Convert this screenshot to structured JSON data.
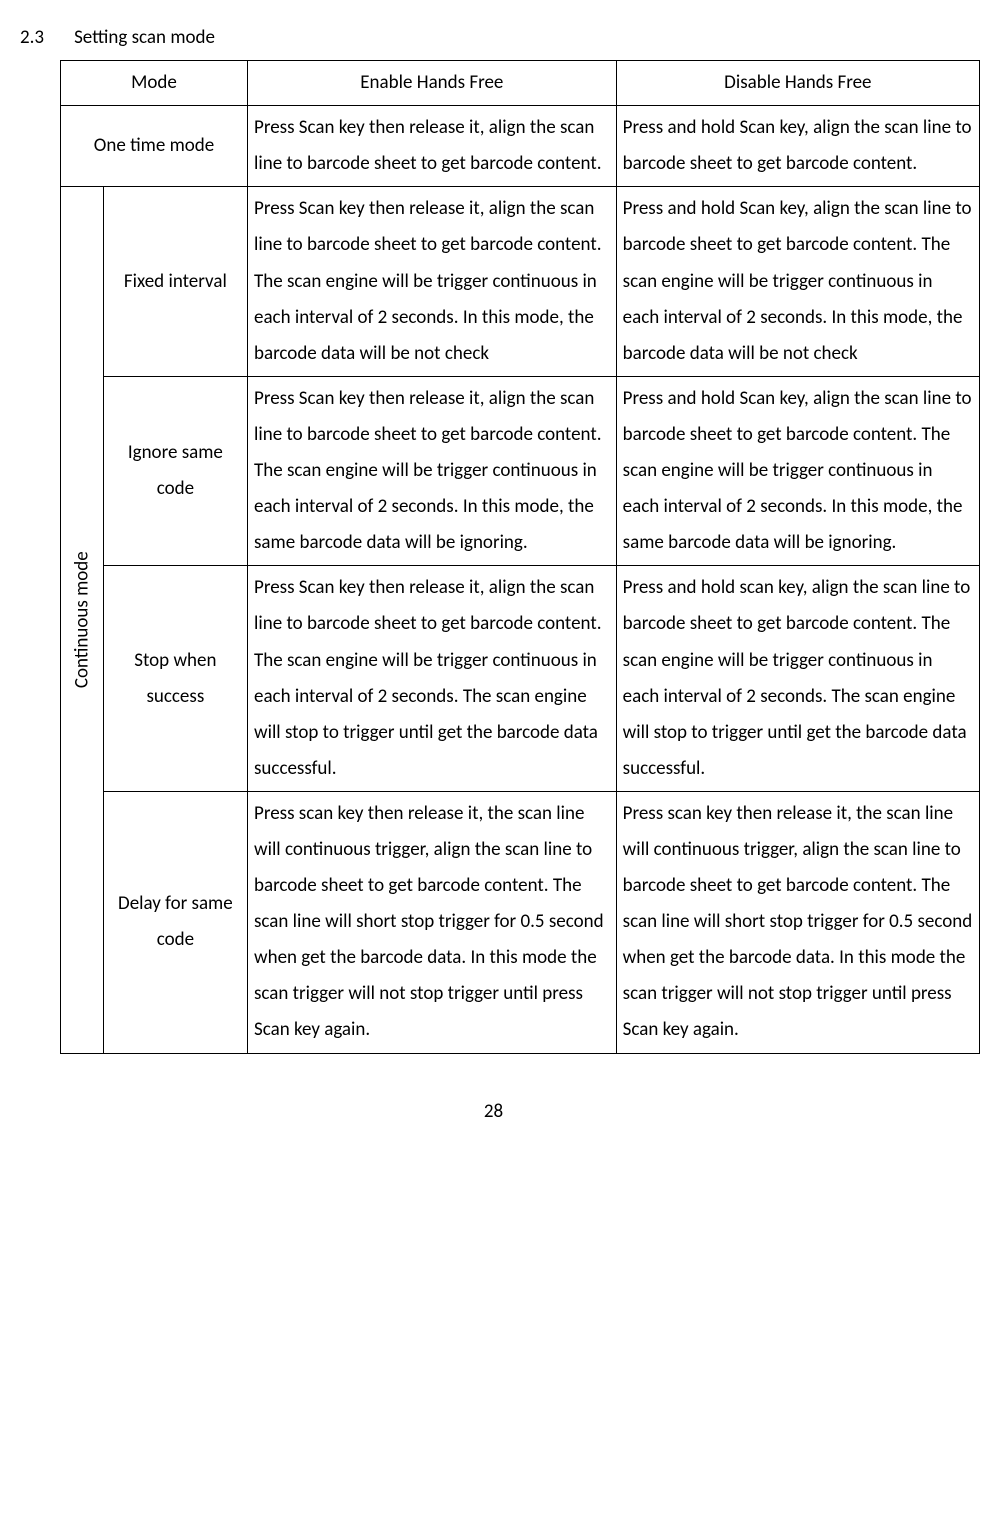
{
  "section": {
    "number": "2.3",
    "title": "Setting scan mode"
  },
  "head": {
    "mode": "Mode",
    "enable": "Enable Hands Free",
    "disable": "Disable Hands Free"
  },
  "r1": {
    "label": "One time mode",
    "en": "Press Scan key then release it, align the scan line to barcode sheet to get barcode content.",
    "dis": "Press and hold Scan key, align the scan line to barcode sheet to get barcode content."
  },
  "group": "Continuous mode",
  "r2": {
    "label": "Fixed interval",
    "en": "Press Scan key then release it, align the scan line to barcode sheet to get barcode content.\nThe scan engine will be trigger continuous in each interval of 2 seconds. In this mode, the barcode data will be not check",
    "dis": "Press and hold Scan key, align the scan line to barcode sheet to get barcode content.\nThe scan engine will be trigger continuous in each interval of 2 seconds. In this mode, the barcode data will be not check"
  },
  "r3": {
    "label": "Ignore same code",
    "en": "Press Scan key then release it, align the scan line to barcode sheet to get barcode content.\nThe scan engine will be trigger continuous in each interval of 2 seconds. In this mode, the same barcode data will be ignoring.",
    "dis": "Press and hold Scan key, align the scan line to barcode sheet to get barcode content.\nThe scan engine will be trigger continuous in each interval of 2 seconds. In this mode, the same barcode data will be ignoring."
  },
  "r4": {
    "label": "Stop when success",
    "en": "Press Scan key then release it, align the scan line to barcode sheet to get barcode content.\nThe scan engine will be trigger continuous in each interval of 2 seconds. The scan engine will stop to trigger until get the barcode data successful.",
    "dis": "Press and hold scan key, align the scan line to barcode sheet to get barcode content.\nThe scan engine will be trigger continuous in each interval of 2 seconds. The scan engine will stop to trigger until get the barcode data successful."
  },
  "r5": {
    "label": "Delay for same code",
    "en": "Press scan key then release it, the scan line will continuous trigger, align the scan line to barcode sheet to get barcode content. The scan line will short stop trigger for 0.5 second when get the barcode data. In this mode the scan trigger will not stop trigger until press Scan key again.",
    "dis": "Press scan key then release it, the scan line will continuous trigger, align the scan line to barcode sheet to get barcode content. The scan line will short stop trigger for 0.5 second when get the barcode data. In this mode the scan trigger will not stop trigger until press Scan key again."
  },
  "page": "28"
}
